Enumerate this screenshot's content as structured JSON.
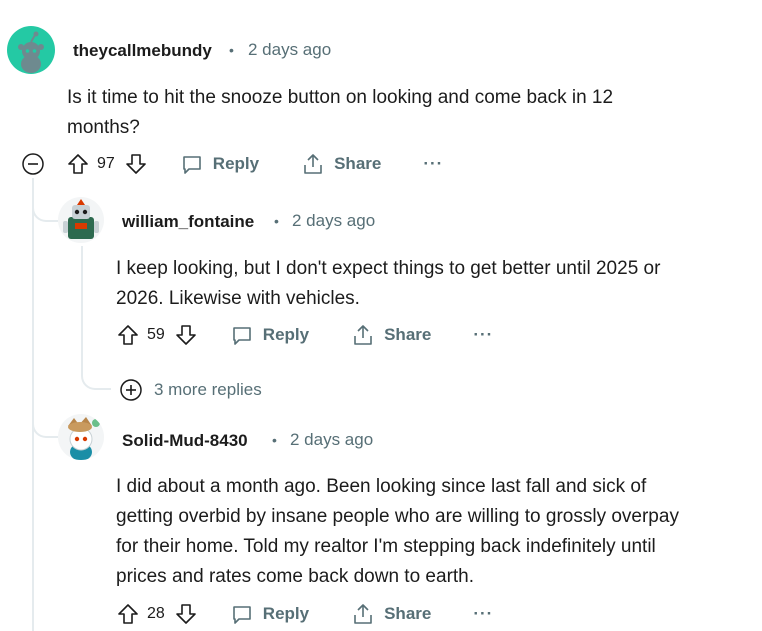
{
  "comments": [
    {
      "author": "theycallmebundy",
      "separator": "•",
      "time": "2 days ago",
      "text": "Is it time to hit the snooze button on looking and come back in 12\nmonths?",
      "score": "97",
      "reply_label": "Reply",
      "share_label": "Share",
      "more_label": "···"
    },
    {
      "author": "william_fontaine",
      "separator": "•",
      "time": "2 days ago",
      "text": "I keep looking, but I don't expect things to get better until 2025 or\n2026. Likewise with vehicles.",
      "score": "59",
      "reply_label": "Reply",
      "share_label": "Share",
      "more_label": "···"
    },
    {
      "author": "Solid-Mud-8430",
      "separator": "•",
      "time": "2 days ago",
      "text": "I did about a month ago. Been looking since last fall and sick of\ngetting overbid by insane people who are willing to grossly overpay\nfor their home. Told my realtor I'm stepping back indefinitely until\nprices and rates come back down to earth.",
      "score": "28",
      "reply_label": "Reply",
      "share_label": "Share",
      "more_label": "···"
    }
  ],
  "more_replies": {
    "label": "3 more replies",
    "icon": "plus-circle-icon"
  },
  "collapse": {
    "icon": "minus-circle-icon"
  },
  "colors": {
    "meta": "#576f76",
    "text": "#1c1c1c",
    "thread": "#e5ebee",
    "avatar_green": "#24c9a4"
  }
}
